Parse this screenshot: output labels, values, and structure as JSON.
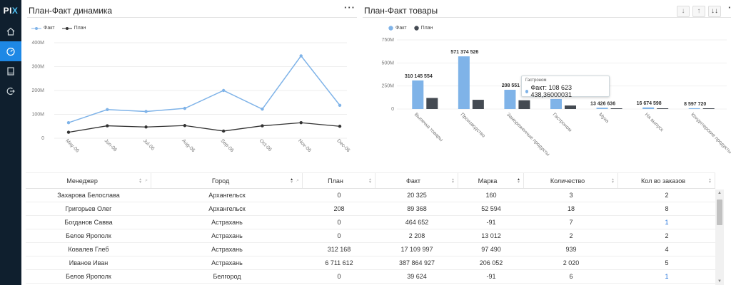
{
  "app": {
    "logo_main": "PI",
    "logo_accent": "X"
  },
  "sidebar": {
    "items": [
      {
        "icon": "home-icon"
      },
      {
        "icon": "dashboard-icon",
        "active": true
      },
      {
        "icon": "book-icon"
      },
      {
        "icon": "logout-icon"
      }
    ]
  },
  "left_panel": {
    "title": "План-Факт динамика",
    "more": "···",
    "legend": [
      {
        "label": "Факт",
        "color": "#7fb3e8"
      },
      {
        "label": "План",
        "color": "#333333"
      }
    ]
  },
  "right_panel": {
    "title": "План-Факт товары",
    "more": "···",
    "tools": [
      "↓",
      "↑",
      "↓↓"
    ],
    "legend": [
      {
        "label": "Факт",
        "color": "#7fb3e8"
      },
      {
        "label": "План",
        "color": "#444a52"
      }
    ],
    "tooltip": {
      "title": "Гастроном",
      "row": "Факт: 108 623 438,36000031"
    }
  },
  "chart_data": [
    {
      "type": "line",
      "title": "План-Факт динамика",
      "x": [
        "May-06",
        "Jun-06",
        "Jul-06",
        "Aug-06",
        "Sep-06",
        "Oct-06",
        "Nov-06",
        "Dec-06"
      ],
      "y_ticks": [
        "400M",
        "300M",
        "200M",
        "100M",
        "0"
      ],
      "ylim": [
        0,
        400000000
      ],
      "series": [
        {
          "name": "Факт",
          "color": "#7fb3e8",
          "values": [
            65000000,
            120000000,
            112000000,
            125000000,
            200000000,
            122000000,
            345000000,
            138000000
          ]
        },
        {
          "name": "План",
          "color": "#333333",
          "values": [
            25000000,
            52000000,
            47000000,
            53000000,
            30000000,
            52000000,
            65000000,
            50000000
          ]
        }
      ],
      "legend": "top-left",
      "grid": true
    },
    {
      "type": "bar",
      "title": "План-Факт товары",
      "categories": [
        "Выпечка товары",
        "Производство",
        "Замороженные продукты",
        "Гастроном",
        "Мука",
        "На выпуск",
        "Кондитерские продукты"
      ],
      "y_ticks": [
        "750M",
        "500M",
        "250M",
        "0"
      ],
      "ylim": [
        0,
        750000000
      ],
      "series": [
        {
          "name": "Факт",
          "color": "#7fb3e8",
          "values": [
            310145554,
            571374526,
            208551000,
            108623438,
            13426636,
            16674598,
            8597720
          ]
        },
        {
          "name": "План",
          "color": "#444a52",
          "values": [
            120000000,
            100000000,
            95000000,
            38000000,
            6000000,
            5000000,
            2000000
          ]
        }
      ],
      "data_labels": [
        "310 145 554",
        "571 374 526",
        "208 551",
        "",
        "13 426 636",
        "16 674 598",
        "8 597 720"
      ],
      "legend": "top-left"
    }
  ],
  "table": {
    "columns": [
      {
        "label": "Менеджер",
        "sort": "none",
        "filter": true
      },
      {
        "label": "Город",
        "sort": "asc",
        "filter": true
      },
      {
        "label": "План",
        "sort": "none"
      },
      {
        "label": "Факт",
        "sort": "none"
      },
      {
        "label": "Марка",
        "sort": "asc"
      },
      {
        "label": "Количество",
        "sort": "none"
      },
      {
        "label": "Кол во заказов",
        "sort": "none"
      }
    ],
    "rows": [
      [
        "Захарова Белослава",
        "Архангельск",
        "0",
        "20 325",
        "160",
        "3",
        "2"
      ],
      [
        "Григорьев Олег",
        "Архангельск",
        "208",
        "89 368",
        "52 594",
        "18",
        "8"
      ],
      [
        "Богданов Савва",
        "Астрахань",
        "0",
        "464 652",
        "-91",
        "7",
        "1"
      ],
      [
        "Белов Ярополк",
        "Астрахань",
        "0",
        "2 208",
        "13 012",
        "2",
        "2"
      ],
      [
        "Ковалев Глеб",
        "Астрахань",
        "312 168",
        "17 109 997",
        "97 490",
        "939",
        "4"
      ],
      [
        "Иванов Иван",
        "Астрахань",
        "6 711 612",
        "387 864 927",
        "206 052",
        "2 020",
        "5"
      ],
      [
        "Белов Ярополк",
        "Белгород",
        "0",
        "39 624",
        "-91",
        "6",
        "1"
      ]
    ],
    "link_rows": [
      2,
      6
    ]
  }
}
